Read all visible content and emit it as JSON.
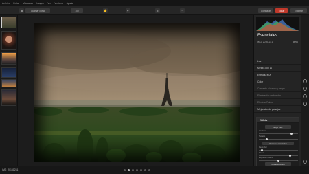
{
  "menu": {
    "items": [
      "Archivo",
      "Editar",
      "Máscaras",
      "Imagen",
      "Ver",
      "Ventana",
      "Ayuda"
    ]
  },
  "toolbar": {
    "open_label": "Abrir",
    "batch_label": "Guardar como",
    "zoom_label": "100",
    "compare_label": "Comparar",
    "edit_label": "Editar",
    "export_label": "Exportar"
  },
  "panel": {
    "title": "Esenciales",
    "file_label": "IMG_20161231",
    "file_right": "8096",
    "sections": [
      {
        "label": "Luz",
        "state": "normal"
      },
      {
        "label": "Mejora con IA",
        "state": "normal"
      },
      {
        "label": "Estructura IA",
        "state": "normal"
      },
      {
        "label": "Color",
        "state": "normal"
      },
      {
        "label": "Convertir a blanco y negro",
        "state": "dim"
      },
      {
        "label": "Eliminación de bandas",
        "state": "dim"
      },
      {
        "label": "Eliminar Ruido",
        "state": "dim"
      },
      {
        "label": "Mejorador de paisajes",
        "state": "normal"
      },
      {
        "label": "Viñeta",
        "state": "highlight"
      }
    ],
    "vignette": {
      "mode_chip": "Edge view",
      "controls": [
        {
          "label": "Cantidad",
          "value": 0.86
        },
        {
          "label": "Tamaño",
          "value": 0.18
        },
        {
          "label": "Redondez",
          "value": 0.06
        },
        {
          "label": "Pluma",
          "value": 0.82
        },
        {
          "label": "Exposición interior",
          "value": 0.5
        }
      ],
      "custom_chip": "Opciones avanzadas",
      "center_button": "Ubicar el centro"
    }
  },
  "statusbar": {
    "filename": "IMG_20161231",
    "pages": 7,
    "active_page": 1
  },
  "colors": {
    "accent": "#c0392b",
    "panel_bg": "#242424",
    "canvas_bg": "#1c1c1c"
  }
}
